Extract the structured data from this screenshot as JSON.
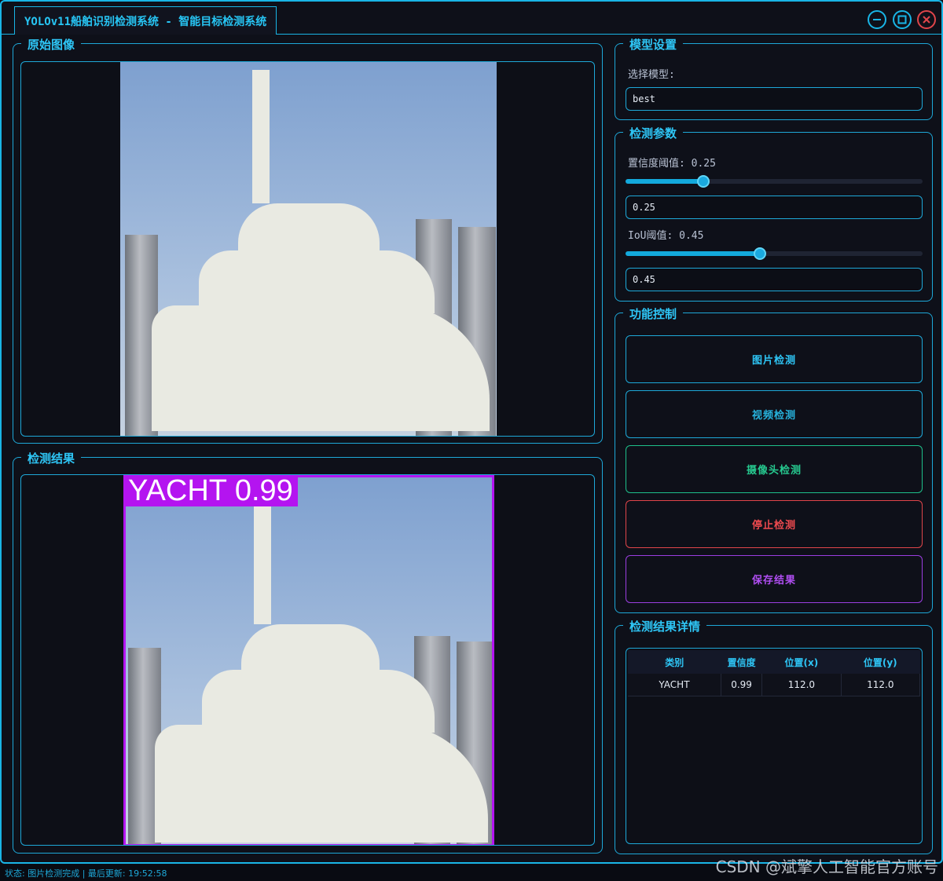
{
  "window": {
    "title": "YOLOv11船舶识别检测系统 - 智能目标检测系统",
    "controls": [
      "minimize-icon",
      "maximize-icon",
      "close-icon"
    ]
  },
  "panels": {
    "original": {
      "title": "原始图像"
    },
    "result": {
      "title": "检测结果",
      "detection_label": "YACHT 0.99",
      "box_color": "#b414f0"
    }
  },
  "model_settings": {
    "title": "模型设置",
    "select_label": "选择模型:",
    "selected": "best"
  },
  "params": {
    "title": "检测参数",
    "conf_label": "置信度阈值: 0.25",
    "conf_value": 0.25,
    "conf_input": "0.25",
    "iou_label": "IoU阈值: 0.45",
    "iou_value": 0.45,
    "iou_input": "0.45"
  },
  "controls": {
    "title": "功能控制",
    "image_detect": "图片检测",
    "video_detect": "视频检测",
    "camera_detect": "摄像头检测",
    "stop_detect": "停止检测",
    "save_result": "保存结果"
  },
  "details": {
    "title": "检测结果详情",
    "columns": [
      "类别",
      "置信度",
      "位置(x)",
      "位置(y)"
    ],
    "rows": [
      [
        "YACHT",
        "0.99",
        "112.0",
        "112.0"
      ]
    ]
  },
  "status": {
    "text": "状态: 图片检测完成 | 最后更新: 19:52:58"
  },
  "watermark": "CSDN @斌擎人工智能官方账号",
  "colors": {
    "accent": "#19b5e6",
    "stop": "#e0454a",
    "camera": "#1ebf8a",
    "save": "#9b3ee0"
  }
}
